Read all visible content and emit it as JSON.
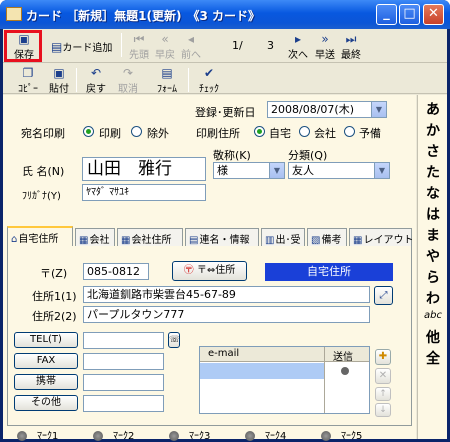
{
  "window": {
    "title": "カード ［新規］無題1(更新)　《3 カード》",
    "minimize_label": "_",
    "maximize_label": "□",
    "close_label": "✕"
  },
  "toolbar1": {
    "save": "保存",
    "add_card": "カード追加",
    "first": "先頭",
    "prev_fast": "早戻",
    "prev": "前へ",
    "position": "1/",
    "total": "3",
    "next": "次へ",
    "next_fast": "早送",
    "last": "最終"
  },
  "toolbar2": {
    "copy": "ｺﾋﾟｰ",
    "paste": "貼付",
    "undo": "戻す",
    "cancel": "取消",
    "form": "ﾌｫｰﾑ",
    "check": "ﾁｪｯｸ"
  },
  "form": {
    "registered_label": "登録･更新日",
    "registered_value": "2008/08/07(木)",
    "address_print_label": "宛名印刷",
    "print_yes": "印刷",
    "print_no": "除外",
    "print_address_label": "印刷住所",
    "addr_home": "自宅",
    "addr_company": "会社",
    "addr_reserve": "予備",
    "honorific_label": "敬称(K)",
    "honorific_value": "様",
    "category_label": "分類(Q)",
    "category_value": "友人",
    "name_label": "氏 名(N)",
    "name_value": "山田　雅行",
    "furigana_label": "ﾌﾘｶﾞﾅ(Y)",
    "furigana_value": "ﾔﾏﾀﾞ ﾏｻﾕｷ"
  },
  "tabs": [
    {
      "icon": "⌂",
      "label": "自宅住所"
    },
    {
      "icon": "▦",
      "label": "会社"
    },
    {
      "icon": "▦",
      "label": "会社住所"
    },
    {
      "icon": "▤",
      "label": "連名・情報"
    },
    {
      "icon": "▥",
      "label": "出･受"
    },
    {
      "icon": "▧",
      "label": "備考"
    },
    {
      "icon": "▦",
      "label": "レイアウト"
    }
  ],
  "home_address": {
    "zip_label": "〒(Z)",
    "zip_value": "085-0812",
    "swap_label": "〒⇔住所",
    "address_type": "自宅住所",
    "addr1_label": "住所1(1)",
    "addr1_value": "北海道釧路市柴雲台45-67-89",
    "addr2_label": "住所2(2)",
    "addr2_value": "パープルタウン777",
    "tel_label": "TEL(T)",
    "fax_label": "FAX",
    "mobile_label": "携帯",
    "other_label": "その他",
    "email_header": "e-mail",
    "send_header": "送信"
  },
  "marks": [
    "ﾏｰｸ1",
    "ﾏｰｸ2",
    "ﾏｰｸ3",
    "ﾏｰｸ4",
    "ﾏｰｸ5"
  ],
  "index_sidebar": [
    "あ",
    "か",
    "さ",
    "た",
    "な",
    "は",
    "ま",
    "や",
    "ら",
    "わ",
    "abc",
    "他",
    "全"
  ]
}
